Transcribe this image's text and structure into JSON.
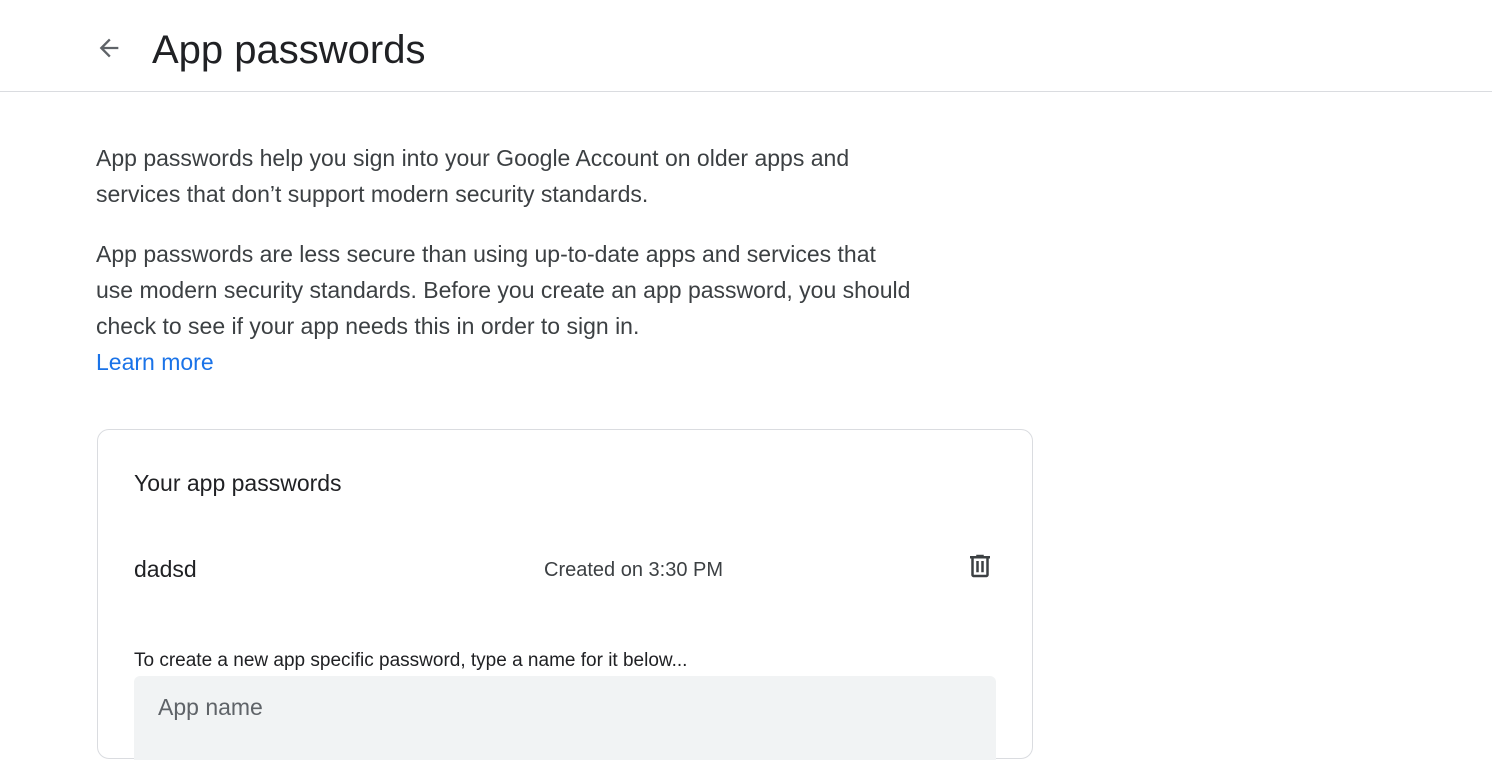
{
  "header": {
    "title": "App passwords",
    "back_icon": "arrow-back-icon"
  },
  "intro": {
    "paragraph1": "App passwords help you sign into your Google Account on older apps and services that don’t support modern security standards.",
    "paragraph2": "App passwords are less secure than using up-to-date apps and services that use modern security standards. Before you create an app password, you should check to see if your app needs this in order to sign in.",
    "learn_more": "Learn more"
  },
  "card": {
    "title": "Your app passwords",
    "passwords": [
      {
        "name": "dadsd",
        "created": "Created on 3:30 PM",
        "delete_icon": "trash-icon"
      }
    ],
    "hint": "To create a new app specific password, type a name for it below...",
    "input": {
      "placeholder": "App name",
      "value": ""
    }
  },
  "colors": {
    "link": "#1a73e8",
    "text": "#202124",
    "secondary_text": "#3c4043",
    "divider": "#dadce0",
    "input_bg": "#f1f3f4"
  }
}
